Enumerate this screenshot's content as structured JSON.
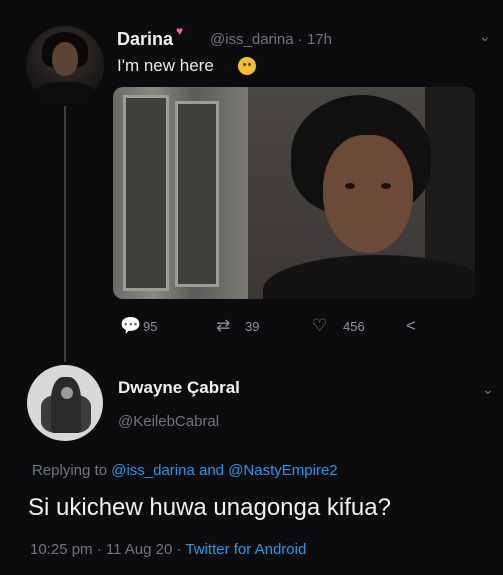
{
  "tweet": {
    "name": "Darina",
    "handle": "@iss_darina",
    "time": "17h",
    "text": "I'm new here",
    "actions": {
      "replies": "95",
      "retweets": "39",
      "likes": "456"
    }
  },
  "reply": {
    "name": "Dwayne Çabral",
    "handle": "@KeilebCabral",
    "replying_prefix": "Replying to",
    "mention1": "@iss_darina",
    "and": "and",
    "mention2": "@NastyEmpire2",
    "text": "Si ukichew huwa unagonga kifua?",
    "timestamp": "10:25 pm · 11 Aug 20 ·",
    "source": "Twitter for Android"
  },
  "colors": {
    "background": "#0b0b0d",
    "link": "#1d9bf0",
    "muted": "#6e767d"
  }
}
